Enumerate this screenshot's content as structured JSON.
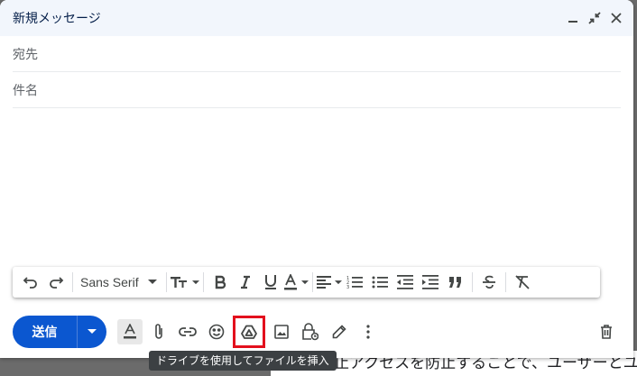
{
  "window": {
    "title": "新規メッセージ"
  },
  "fields": {
    "to_label": "宛先",
    "subject_label": "件名"
  },
  "format_toolbar": {
    "font": "Sans Serif"
  },
  "send": {
    "label": "送信"
  },
  "tooltip": "ドライブを使用してファイルを挿入",
  "background_text": "止アクセスを防止することで、ユーザーとユー",
  "colors": {
    "send_bg": "#0b57d0",
    "highlight": "#e3101d",
    "titlebar_bg": "#f2f6fc"
  },
  "icons": {
    "format_toolbar": [
      "undo-icon",
      "redo-icon",
      "font-size-icon",
      "bold-icon",
      "italic-icon",
      "underline-icon",
      "text-color-icon",
      "align-icon",
      "numbered-list-icon",
      "bulleted-list-icon",
      "indent-less-icon",
      "indent-more-icon",
      "quote-icon",
      "strikethrough-icon",
      "remove-format-icon"
    ],
    "bottom_bar": [
      "formatting-options-icon",
      "attach-icon",
      "link-icon",
      "emoji-icon",
      "drive-icon",
      "photo-icon",
      "confidential-icon",
      "signature-icon",
      "more-options-icon",
      "trash-icon"
    ]
  }
}
